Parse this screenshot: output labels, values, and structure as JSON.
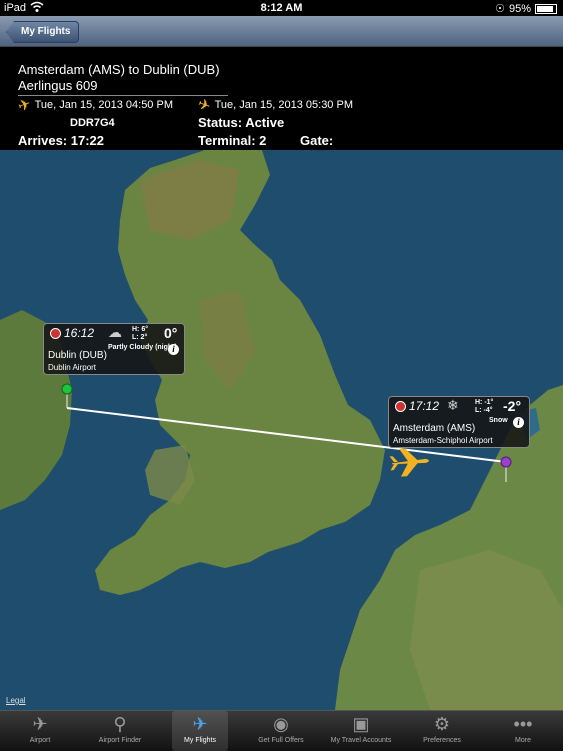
{
  "status_bar": {
    "carrier": "iPad",
    "time": "8:12 AM",
    "battery": "95%"
  },
  "nav": {
    "back_label": "My Flights"
  },
  "flight": {
    "title": "Amsterdam (AMS) to Dublin (DUB)",
    "subtitle": "Aerlingus 609",
    "departure": "Tue, Jan 15, 2013 04:50 PM",
    "arrival": "Tue, Jan 15, 2013 05:30 PM",
    "code": "DDR7G4",
    "status": "Status: Active",
    "arrives": "Arrives: 17:22",
    "terminal": "Terminal: 2",
    "gate": "Gate:"
  },
  "map": {
    "legal": "Legal",
    "dublin": {
      "time": "16:12",
      "high": "H: 6°",
      "low": "L: 2°",
      "temp": "0°",
      "condition": "Partly Cloudy (night)",
      "city": "Dublin (DUB)",
      "airport": "Dublin Airport"
    },
    "amsterdam": {
      "time": "17:12",
      "high": "H: -1°",
      "low": "L: -4°",
      "temp": "-2°",
      "condition": "Snow",
      "city": "Amsterdam (AMS)",
      "airport": "Amsterdam-Schiphol Airport"
    }
  },
  "tabs": [
    {
      "label": "Airport",
      "icon": "airport-icon"
    },
    {
      "label": "Airport Finder",
      "icon": "finder-icon"
    },
    {
      "label": "My Flights",
      "icon": "my-flights-icon",
      "active": true
    },
    {
      "label": "Get Full Offers",
      "icon": "globe-icon"
    },
    {
      "label": "My Travel Accounts",
      "icon": "accounts-icon"
    },
    {
      "label": "Preferences",
      "icon": "gears-icon"
    },
    {
      "label": "More",
      "icon": "more-icon"
    }
  ],
  "colors": {
    "accent": "#f4b223",
    "active_tab": "#4ea3e8",
    "route": "#ffffff",
    "sea": "#1f4d6e",
    "land": "#5c7a3c"
  }
}
